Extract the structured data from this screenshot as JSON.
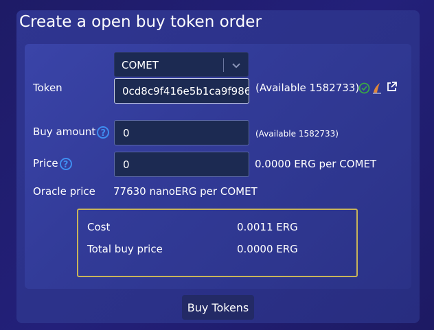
{
  "title": "Create a open buy token order",
  "token": {
    "label": "Token",
    "selected": "COMET",
    "token_id": "0cd8c9f416e5b1ca9f986",
    "available": "(Available 1582733)"
  },
  "buy_amount": {
    "label": "Buy amount",
    "help": "?",
    "value": "0",
    "available": "(Available 1582733)"
  },
  "price": {
    "label": "Price",
    "help": "?",
    "value": "0",
    "per_text": "0.0000 ERG per COMET"
  },
  "oracle": {
    "label": "Oracle price",
    "value": "77630 nanoERG per COMET"
  },
  "cost": {
    "cost_label": "Cost",
    "cost_value": "0.0011 ERG",
    "total_label": "Total buy price",
    "total_value": "0.0000 ERG"
  },
  "buy_button": "Buy Tokens",
  "colors": {
    "accent_border": "#c8b45a",
    "help_blue": "#3f8df0",
    "verified_green": "#3aa845"
  },
  "icons": [
    "chevron-down-icon",
    "verified-check-icon",
    "spectrum-icon",
    "external-link-icon",
    "help-icon"
  ]
}
